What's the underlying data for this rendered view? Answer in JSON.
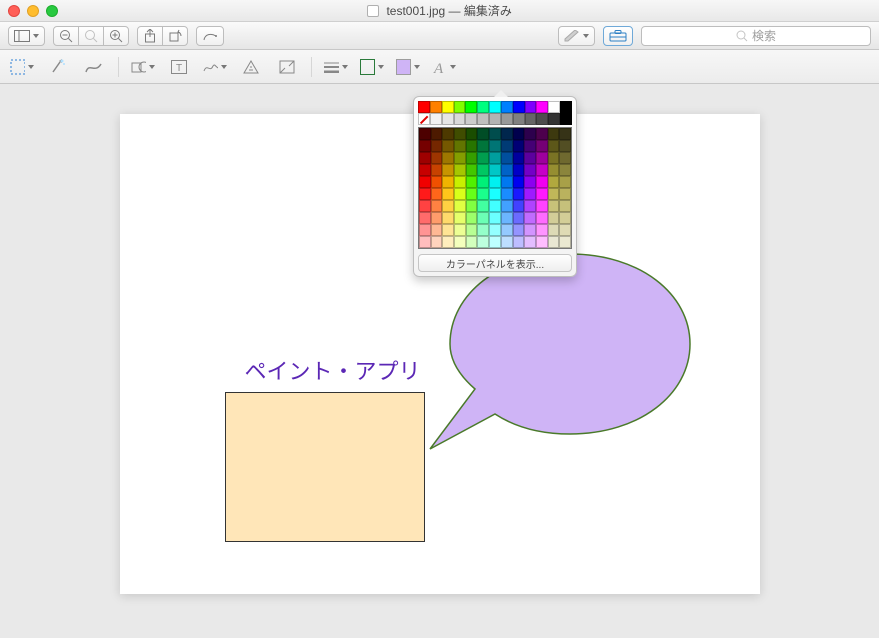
{
  "title": {
    "filename": "test001.jpg",
    "status": "編集済み"
  },
  "search": {
    "placeholder": "検索"
  },
  "colorpanel": {
    "show_label": "カラーパネルを表示..."
  },
  "canvas": {
    "text": "ペイント・アプリ"
  },
  "colors": {
    "border_swatch": "#2a7a3a",
    "fill_swatch": "#cfb4f6",
    "bubble_fill": "#cfb4f6",
    "bubble_stroke": "#4a7a2a",
    "rect_fill": "#ffe6b8",
    "palette_top": [
      "#ff0000",
      "#ff8000",
      "#ffff00",
      "#80ff00",
      "#00ff00",
      "#00ff80",
      "#00ffff",
      "#0080ff",
      "#0000ff",
      "#8000ff",
      "#ff00ff",
      "#ffffff",
      "#000000"
    ],
    "grays": [
      "#ffffff",
      "#f2f2f2",
      "#e6e6e6",
      "#d9d9d9",
      "#cccccc",
      "#bfbfbf",
      "#b3b3b3",
      "#999999",
      "#808080",
      "#666666",
      "#4d4d4d",
      "#333333",
      "#000000"
    ]
  }
}
